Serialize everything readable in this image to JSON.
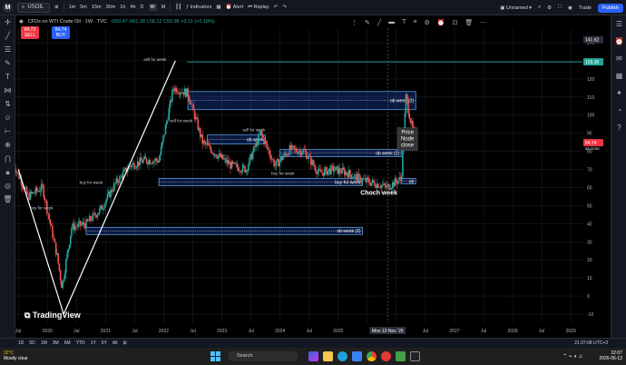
{
  "topbar": {
    "symbol": "USOIL",
    "intervals": [
      "1m",
      "5m",
      "15m",
      "30m",
      "1h",
      "4h",
      "D",
      "W",
      "M"
    ],
    "active_interval": "W",
    "indicators_label": "Indicators",
    "alert_label": "Alert",
    "replay_label": "Replay",
    "layout_name": "Unnamed",
    "trade_label": "Trade",
    "publish_label": "Publish"
  },
  "legend": {
    "title": "CFDs on WTI Crude Oil · 1W · TVC",
    "ohlc": "O59.47 H61.28 L58.12 C59.96 +0.11 (+0.18%)",
    "sell_price": "84.72",
    "sell_label": "SELL",
    "buy_price": "84.74",
    "buy_label": "BUY",
    "sell_color": "#f23645",
    "buy_color": "#2962ff"
  },
  "chart_data": {
    "type": "candlestick",
    "symbol": "USOIL",
    "timeframe": "1W",
    "x_ticks": [
      "Jul",
      "2020",
      "Jul",
      "2021",
      "Jul",
      "2022",
      "Jul",
      "2023",
      "Jul",
      "2024",
      "Jul",
      "2025",
      "Mon 10 Nov '25",
      "Jul",
      "2027",
      "Jul",
      "2028",
      "Jul",
      "2029"
    ],
    "y_ticks": [
      140,
      130,
      120,
      110,
      100,
      90,
      80,
      70,
      60,
      50,
      40,
      30,
      20,
      10,
      0,
      -10
    ],
    "ylim": [
      -15,
      148
    ],
    "price_labels": {
      "top": "141.62",
      "line": "129.36",
      "current": "84.74",
      "countdown": "05:22:50"
    },
    "close_path": [
      [
        "2019-06",
        73
      ],
      [
        "2019-09",
        55
      ],
      [
        "2019-12",
        60
      ],
      [
        "2020-03",
        22
      ],
      [
        "2020-04",
        5
      ],
      [
        "2020-06",
        38
      ],
      [
        "2020-09",
        40
      ],
      [
        "2020-12",
        48
      ],
      [
        "2021-03",
        62
      ],
      [
        "2021-06",
        72
      ],
      [
        "2021-09",
        75
      ],
      [
        "2021-12",
        75
      ],
      [
        "2022-03",
        115
      ],
      [
        "2022-06",
        112
      ],
      [
        "2022-09",
        85
      ],
      [
        "2022-12",
        78
      ],
      [
        "2023-03",
        72
      ],
      [
        "2023-06",
        70
      ],
      [
        "2023-09",
        90
      ],
      [
        "2023-12",
        72
      ],
      [
        "2024-03",
        81
      ],
      [
        "2024-06",
        80
      ],
      [
        "2024-09",
        68
      ],
      [
        "2024-12",
        70
      ],
      [
        "2025-03",
        68
      ],
      [
        "2025-06",
        64
      ],
      [
        "2025-09",
        62
      ],
      [
        "2025-11",
        60
      ],
      [
        "2026-02",
        65
      ],
      [
        "2026-03",
        110
      ],
      [
        "2026-04",
        96
      ],
      [
        "2026-05",
        85
      ]
    ],
    "zones": [
      {
        "label": "ob week (2)",
        "from": "2022-06",
        "to": "2026-05",
        "low": 103,
        "high": 113
      },
      {
        "label": "ob week",
        "from": "2022-10",
        "to": "2023-10",
        "low": 84,
        "high": 89
      },
      {
        "label": "ob week (2)",
        "from": "2024-01",
        "to": "2026-02",
        "low": 77,
        "high": 81
      },
      {
        "label": "buy for week",
        "from": "2021-12",
        "to": "2025-06",
        "low": 61,
        "high": 65
      },
      {
        "label": "ob",
        "from": "2026-02",
        "to": "2026-05",
        "low": 62,
        "high": 65
      },
      {
        "label": "ob week (2)",
        "from": "2020-09",
        "to": "2025-06",
        "low": 34,
        "high": 38
      }
    ],
    "annotations": [
      "sell for week",
      "sell for week",
      "sell for week",
      "buy for week",
      "buy for week",
      "buy for week",
      "Choch week",
      "Price Node close"
    ]
  },
  "bottombar": {
    "ranges": [
      "1D",
      "5D",
      "1M",
      "3M",
      "6M",
      "YTD",
      "1Y",
      "5Y",
      "All"
    ],
    "clock": "21:37:08 UTC+3"
  },
  "taskbar": {
    "temperature": "32°C",
    "weather": "Mostly clear",
    "search_placeholder": "Search",
    "time": "22:07",
    "date": "2026-06-12"
  }
}
